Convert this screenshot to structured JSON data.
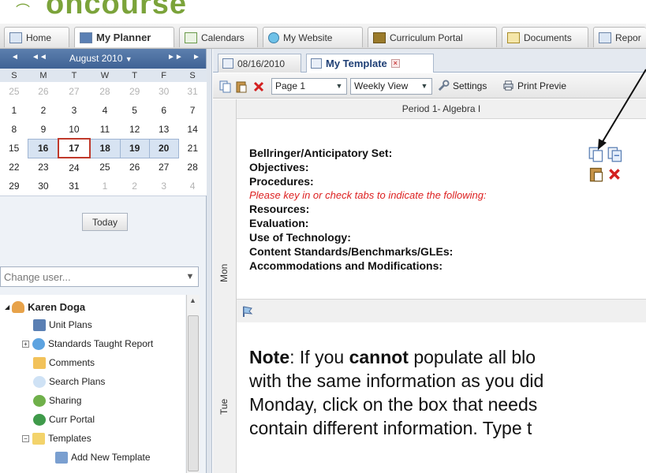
{
  "app": {
    "logo_text": "oncourse"
  },
  "topnav": [
    {
      "label": "Home"
    },
    {
      "label": "My Planner"
    },
    {
      "label": "Calendars"
    },
    {
      "label": "My Website"
    },
    {
      "label": "Curriculum Portal"
    },
    {
      "label": "Documents"
    },
    {
      "label": "Repor"
    }
  ],
  "calendar": {
    "month": "August 2010",
    "month_dropdown": "▼",
    "prev_year": "◄",
    "prev_month": "◄◄",
    "next_month": "►►",
    "next_year": "►",
    "weekdays": [
      "S",
      "M",
      "T",
      "W",
      "T",
      "F",
      "S"
    ],
    "weeks": [
      [
        "25",
        "26",
        "27",
        "28",
        "29",
        "30",
        "31"
      ],
      [
        "1",
        "2",
        "3",
        "4",
        "5",
        "6",
        "7"
      ],
      [
        "8",
        "9",
        "10",
        "11",
        "12",
        "13",
        "14"
      ],
      [
        "15",
        "16",
        "17",
        "18",
        "19",
        "20",
        "21"
      ],
      [
        "22",
        "23",
        "24",
        "25",
        "26",
        "27",
        "28"
      ],
      [
        "29",
        "30",
        "31",
        "1",
        "2",
        "3",
        "4"
      ]
    ],
    "today_label": "Today"
  },
  "change_user": {
    "placeholder": "Change user..."
  },
  "tree": {
    "user": "Karen Doga",
    "items": [
      "Unit Plans",
      "Standards Taught Report",
      "Comments",
      "Search Plans",
      "Sharing",
      "Curr Portal",
      "Templates",
      "Add New Template"
    ]
  },
  "doc_tabs": [
    {
      "label": "08/16/2010"
    },
    {
      "label": "My Template"
    }
  ],
  "toolbar": {
    "page_select": "Page 1",
    "view_select": "Weekly View",
    "settings": "Settings",
    "print_preview": "Print Previe"
  },
  "planner": {
    "period": "Period 1- Algebra I",
    "days": [
      "Mon",
      "Tue"
    ],
    "monday_lines": [
      "Bellringer/Anticipatory Set:",
      "Objectives:",
      "Procedures:",
      "Please key in or check tabs to indicate the following:",
      "Resources:",
      "Evaluation:",
      "Use of Technology:",
      "Content Standards/Benchmarks/GLEs:",
      "Accommodations and Modifications:"
    ]
  },
  "note": {
    "label": "Note",
    "t1": ":  If you ",
    "bold": "cannot",
    "t2": " populate all blo",
    "line2": "with the same information as you did",
    "line3": "Monday, click on the box that needs",
    "line4": "contain different information.  Type t"
  },
  "colors": {
    "brand": "#7ba33a",
    "calendar_header": "#4a6fa3",
    "instruction_red": "#d22222"
  }
}
